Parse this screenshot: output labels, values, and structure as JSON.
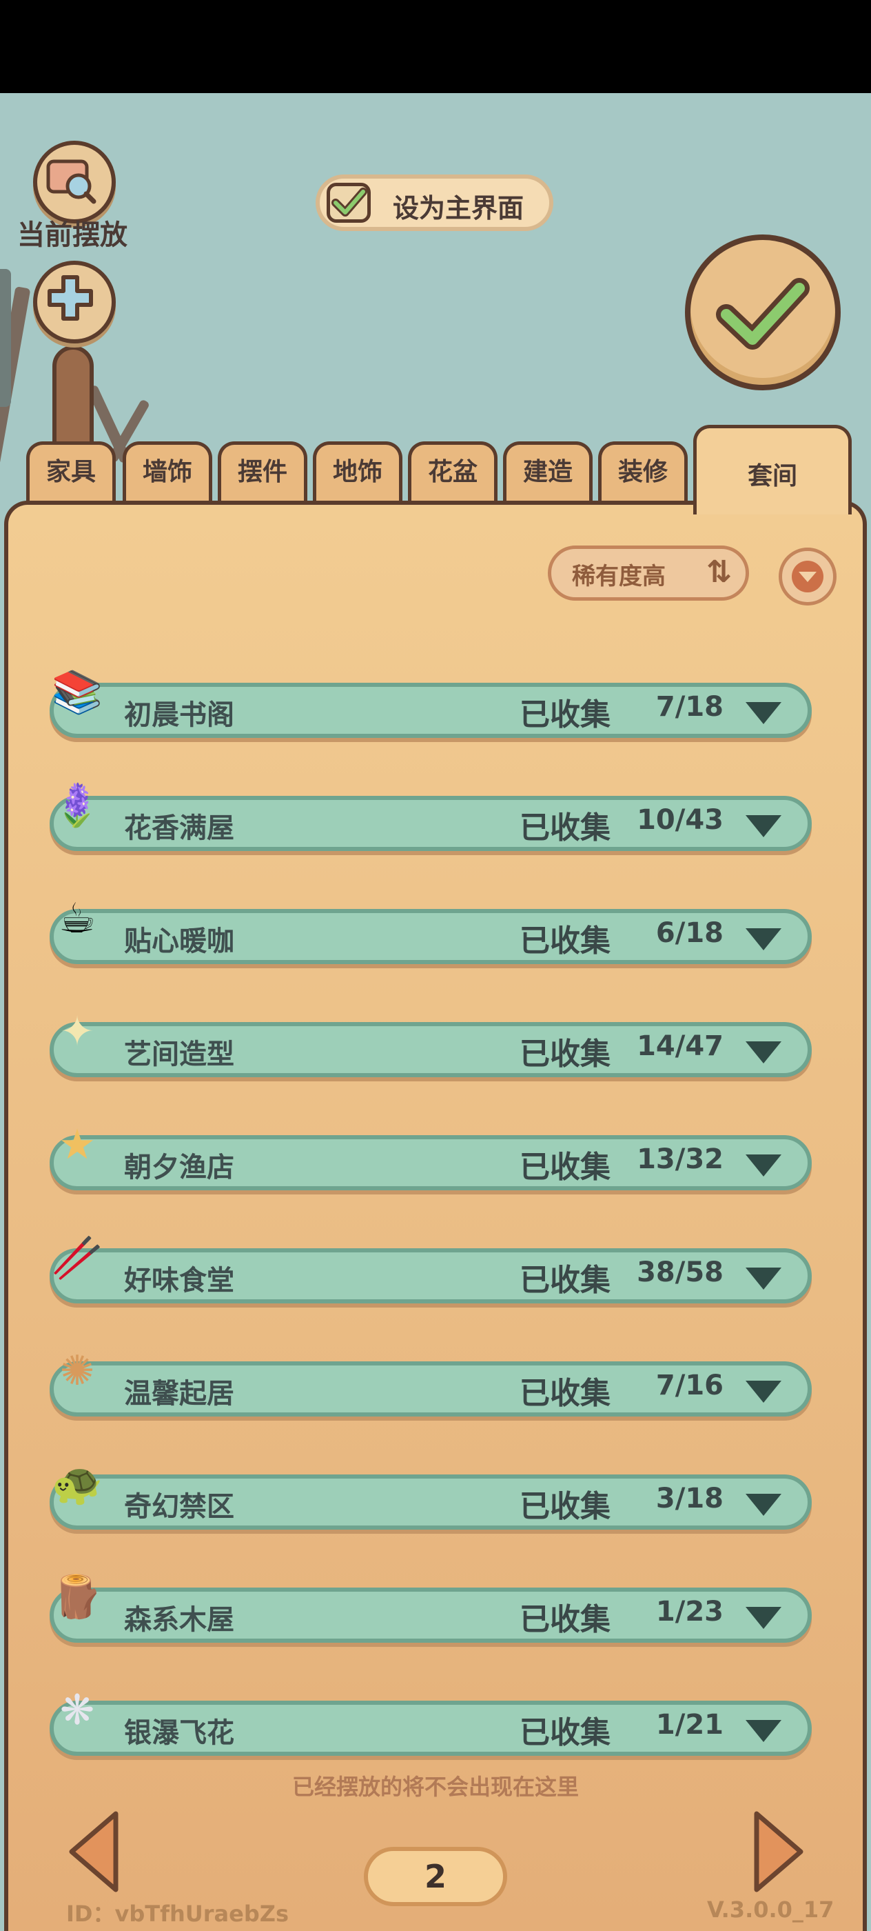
{
  "top_left": {
    "placed_label": "当前摆放"
  },
  "main_toggle": {
    "label": "设为主界面",
    "checked": true
  },
  "tabs": [
    {
      "label": "家具"
    },
    {
      "label": "墙饰"
    },
    {
      "label": "摆件"
    },
    {
      "label": "地饰"
    },
    {
      "label": "花盆"
    },
    {
      "label": "建造"
    },
    {
      "label": "装修"
    },
    {
      "label": "套间",
      "active": true
    }
  ],
  "sort": {
    "label": "稀有度高",
    "icon": "sort-updown-icon"
  },
  "sets": [
    {
      "name": "初晨书阁",
      "status": "已收集",
      "count": "7/18",
      "icon": "books-icon"
    },
    {
      "name": "花香满屋",
      "status": "已收集",
      "count": "10/43",
      "icon": "lavender-icon"
    },
    {
      "name": "贴心暖咖",
      "status": "已收集",
      "count": "6/18",
      "icon": "coffee-cup-icon"
    },
    {
      "name": "艺间造型",
      "status": "已收集",
      "count": "14/47",
      "icon": "sparkle-icon"
    },
    {
      "name": "朝夕渔店",
      "status": "已收集",
      "count": "13/32",
      "icon": "starfish-icon"
    },
    {
      "name": "好味食堂",
      "status": "已收集",
      "count": "38/58",
      "icon": "utensil-cup-icon"
    },
    {
      "name": "温馨起居",
      "status": "已收集",
      "count": "7/16",
      "icon": "sun-rug-icon"
    },
    {
      "name": "奇幻禁区",
      "status": "已收集",
      "count": "3/18",
      "icon": "turtle-icon"
    },
    {
      "name": "森系木屋",
      "status": "已收集",
      "count": "1/23",
      "icon": "tree-stump-icon"
    },
    {
      "name": "银瀑飞花",
      "status": "已收集",
      "count": "1/21",
      "icon": "silver-flower-icon"
    }
  ],
  "footer": {
    "hint": "已经摆放的将不会出现在这里",
    "page": "2",
    "id_text": "ID：vbTfhUraebZs",
    "version": "V.3.0.0_17"
  },
  "colors": {
    "row_bg": "#9dcfb8",
    "panel_bg": "#f2cc92",
    "outline": "#5b3c2c",
    "sky": "#a6c8c5"
  }
}
